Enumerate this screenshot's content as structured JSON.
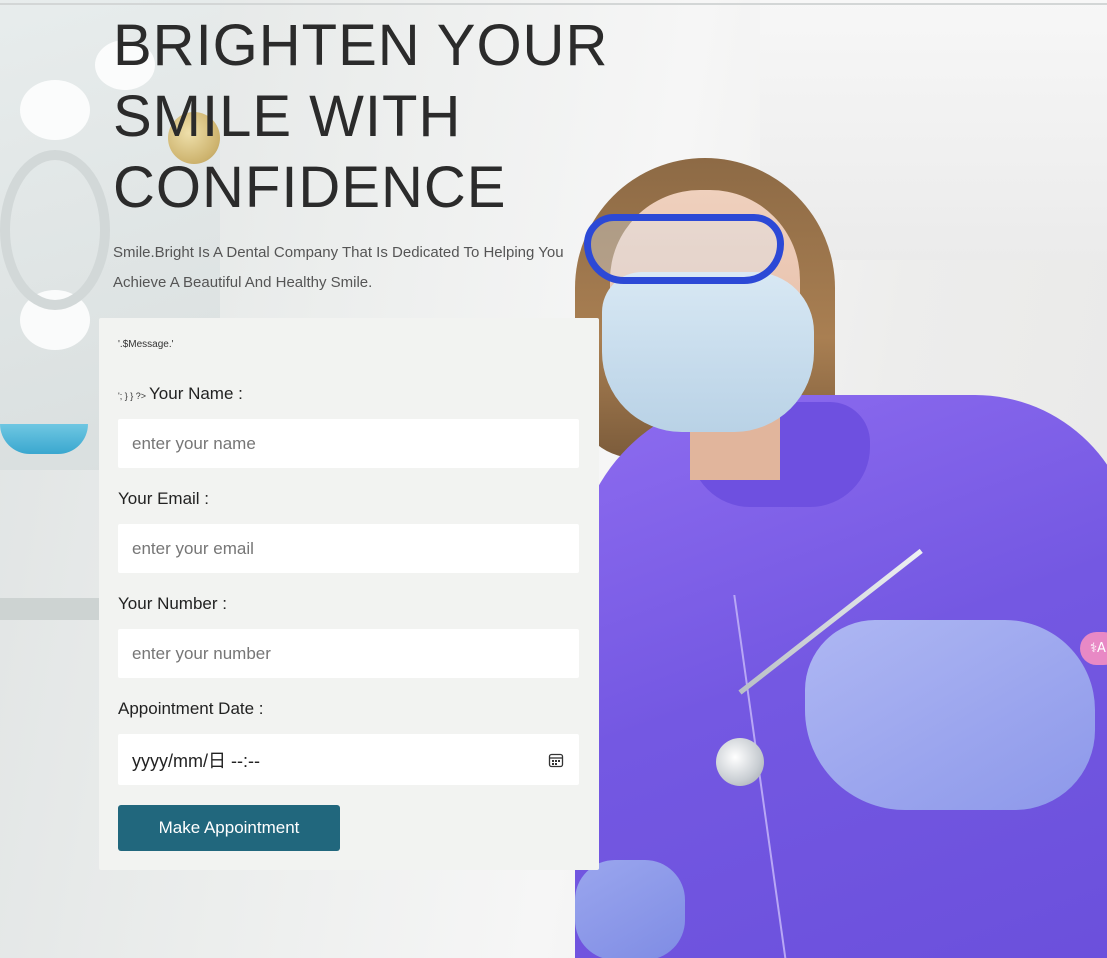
{
  "hero": {
    "title": "BRIGHTEN YOUR SMILE WITH CONFIDENCE",
    "subtitle": "Smile.Bright Is A Dental Company That Is Dedicated To Helping You Achieve A Beautiful And Healthy Smile."
  },
  "form": {
    "message": "'.$Message.'",
    "stray_code": "'; } } ?>",
    "name_label": "Your Name :",
    "name_placeholder": "enter your name",
    "email_label": "Your Email :",
    "email_placeholder": "enter your email",
    "number_label": "Your Number :",
    "number_placeholder": "enter your number",
    "date_label": "Appointment Date :",
    "date_value": "yyyy/mm/日 --:--",
    "submit_label": "Make Appointment"
  },
  "side_widget": {
    "icon": "translate-icon",
    "text": "⚕A"
  },
  "colors": {
    "button": "#21677d",
    "card": "#f2f3f1",
    "title": "#2b2b2b"
  }
}
